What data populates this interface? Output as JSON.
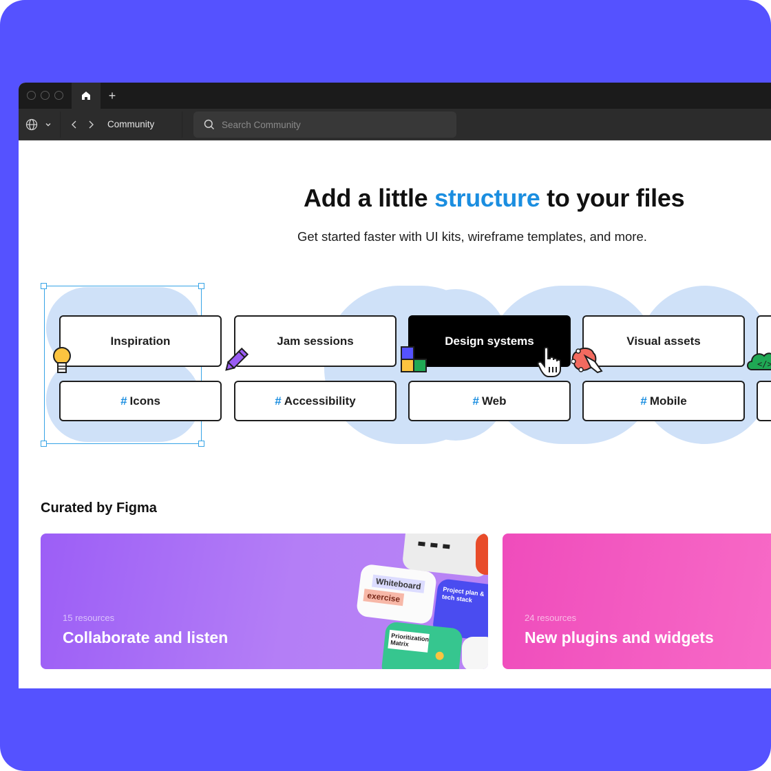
{
  "colors": {
    "frame_background": "#5552ff",
    "accent_blue": "#1b8ee0",
    "selection_blue": "#35a3e6",
    "blob_blue": "#cfe1f8",
    "card_purple": "#a56cf6",
    "card_pink": "#f45ec2"
  },
  "browser": {
    "tabs": [
      {
        "icon": "home-icon",
        "active": true
      }
    ],
    "new_tab_label": "+",
    "nav": {
      "language_icon": "globe-icon",
      "breadcrumb": "Community"
    },
    "search": {
      "placeholder": "Search Community",
      "value": ""
    }
  },
  "hero": {
    "title_before": "Add a little ",
    "title_accent": "structure",
    "title_after": " to your files",
    "subtitle": "Get started faster with UI kits, wireframe templates, and more."
  },
  "categories": {
    "primary": [
      {
        "label": "Inspiration",
        "icon": "lightbulb-icon",
        "selected": false
      },
      {
        "label": "Jam sessions",
        "icon": "pencil-icon",
        "selected": false
      },
      {
        "label": "Design systems",
        "icon": "components-grid-icon",
        "selected": true
      },
      {
        "label": "Visual assets",
        "icon": "pen-tool-icon",
        "selected": false
      },
      {
        "label": "",
        "icon": "code-cloud-icon",
        "selected": false
      }
    ],
    "tags": [
      {
        "hash": "#",
        "label": "Icons"
      },
      {
        "hash": "#",
        "label": "Accessibility"
      },
      {
        "hash": "#",
        "label": "Web"
      },
      {
        "hash": "#",
        "label": "Mobile"
      },
      {
        "hash": "#",
        "label": ""
      }
    ]
  },
  "curated": {
    "title": "Curated by Figma",
    "cards": [
      {
        "count": "15 resources",
        "title": "Collaborate and listen",
        "thumbnails": [
          "Whiteboard",
          "exercise",
          "Project plan & tech stack",
          "Prioritization Matrix"
        ]
      },
      {
        "count": "24 resources",
        "title": "New plugins and widgets"
      }
    ]
  }
}
